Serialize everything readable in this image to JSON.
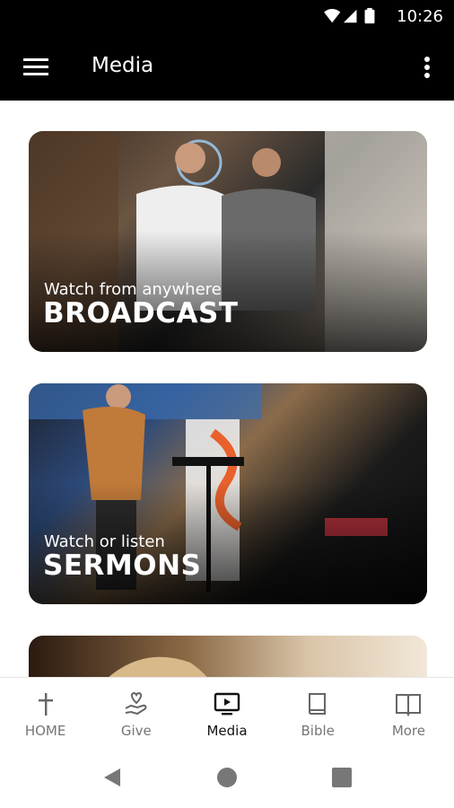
{
  "status_bar": {
    "time": "10:26"
  },
  "app_bar": {
    "title": "Media",
    "menu_icon": "hamburger-menu-icon",
    "overflow_icon": "more-vert-icon"
  },
  "cards": [
    {
      "subtitle": "Watch from anywhere",
      "title": "BROADCAST"
    },
    {
      "subtitle": "Watch or listen",
      "title": "SERMONS"
    },
    {
      "subtitle": "",
      "title": ""
    }
  ],
  "bottom_nav": {
    "items": [
      {
        "label": "HOME",
        "icon": "cross-icon",
        "active": false
      },
      {
        "label": "Give",
        "icon": "give-hand-heart-icon",
        "active": false
      },
      {
        "label": "Media",
        "icon": "tv-play-icon",
        "active": true
      },
      {
        "label": "Bible",
        "icon": "book-icon",
        "active": false
      },
      {
        "label": "More",
        "icon": "open-book-icon",
        "active": false
      }
    ]
  },
  "colors": {
    "app_bar": "#000000",
    "active_nav": "#111111",
    "inactive_nav": "#757575"
  }
}
